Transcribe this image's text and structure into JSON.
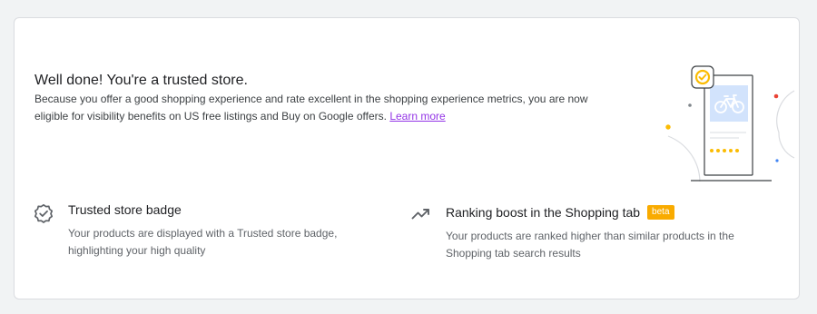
{
  "header": {
    "title": "Well done! You're a trusted store.",
    "description": "Because you offer a good shopping experience and rate excellent in the shopping experience metrics, you are now eligible for visibility benefits on US free listings and Buy on Google offers.",
    "learn_more": "Learn more"
  },
  "benefits": [
    {
      "title": "Trusted store badge",
      "body": "Your products are displayed with a Trusted store badge, highlighting your high quality",
      "icon": "verified-badge-icon"
    },
    {
      "title": "Ranking boost in the Shopping tab",
      "badge": "beta",
      "body": "Your products are ranked higher than similar products in the Shopping tab search results",
      "icon": "trending-up-icon"
    }
  ],
  "colors": {
    "link": "#9334e6",
    "beta_badge": "#f9ab00",
    "illustration_blue": "#8ab4f8",
    "illustration_yellow": "#fbbc04",
    "illustration_red": "#ea4335",
    "illustration_blue_dot": "#4285f4"
  }
}
